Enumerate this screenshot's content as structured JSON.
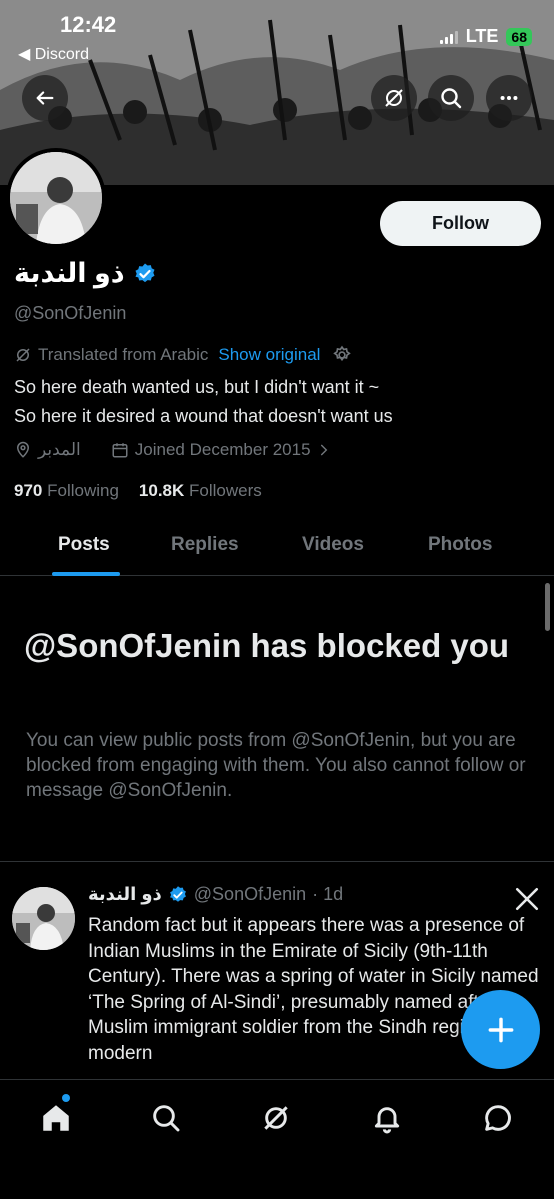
{
  "status_bar": {
    "time": "12:42",
    "back_app": "◀ Discord",
    "network": "LTE",
    "battery": "68"
  },
  "profile": {
    "display_name": "ذو الندبة",
    "handle": "@SonOfJenin",
    "follow_label": "Follow",
    "translated_label": "Translated from Arabic",
    "show_original": "Show original",
    "bio_line1": "So here death wanted us, but I didn't want it ~",
    "bio_line2": "So here it desired a wound that doesn't want us",
    "location": "المدبر",
    "joined": "Joined December 2015",
    "following_count": "970",
    "following_label": "Following",
    "followers_count": "10.8K",
    "followers_label": "Followers"
  },
  "tabs": [
    {
      "label": "Posts"
    },
    {
      "label": "Replies"
    },
    {
      "label": "Videos"
    },
    {
      "label": "Photos"
    }
  ],
  "blocked": {
    "title": "@SonOfJenin has blocked you",
    "text": "You can view public posts from @SonOfJenin, but you are blocked from engaging with them. You also cannot follow or message @SonOfJenin."
  },
  "post": {
    "name": "ذو الندبة",
    "handle": "@SonOfJenin",
    "time": "· 1d",
    "body": "Random fact but it appears there was a presence of Indian Muslims in the Emirate of Sicily (9th-11th Century). There was a spring of water in Sicily named ‘The Spring of Al-Sindi’, presumably named after a Muslim immigrant soldier from the Sindh region of modern"
  },
  "colors": {
    "accent": "#1d9bf0",
    "muted": "#71767b",
    "battery": "#34c759"
  }
}
